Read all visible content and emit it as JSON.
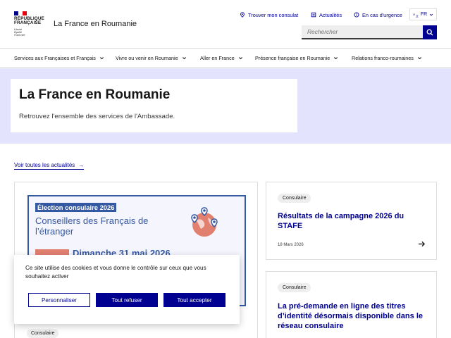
{
  "header": {
    "logo_lines": [
      "RÉPUBLIQUE",
      "FRANÇAISE"
    ],
    "logo_motto": [
      "Liberté",
      "Égalité",
      "Fraternité"
    ],
    "site_title": "La France en Roumanie",
    "top_links": [
      {
        "label": "Trouver mon consulat",
        "icon": "map-pin-icon"
      },
      {
        "label": "Actualités",
        "icon": "newspaper-icon"
      },
      {
        "label": "En cas d'urgence",
        "icon": "info-icon"
      }
    ],
    "language": "FR",
    "search_placeholder": "Rechercher"
  },
  "nav": {
    "items": [
      "Services aux Françaises et Français",
      "Vivre ou venir en Roumanie",
      "Aller en France",
      "Présence française en Roumanie",
      "Relations franco-roumaines"
    ]
  },
  "hero": {
    "title": "La France en Roumanie",
    "subtitle": "Retrouvez l'ensemble des services de l'Ambassade."
  },
  "news": {
    "all_link": "Voir toutes les actualités",
    "main": {
      "poster_tag": "Élection consulaire 2026",
      "poster_title": "Conseillers des Français de l’étranger",
      "poster_date": "Dimanche 31 mai 2026",
      "badge": "Consulaire"
    },
    "cards": [
      {
        "badge": "Consulaire",
        "title": "Résultats de la campagne 2026 du STAFE",
        "date": "18 Mars 2026"
      },
      {
        "badge": "Consulaire",
        "title": "La pré-demande en ligne des titres d’identité désormais disponible dans le réseau consulaire",
        "date": ""
      }
    ]
  },
  "cookie": {
    "text": "Ce site utilise des cookies et vous donne le contrôle sur ceux que vous souhaitez activer",
    "personalize": "Personnaliser",
    "refuse_all": "Tout refuser",
    "accept_all": "Tout accepter"
  },
  "colors": {
    "primary": "#000091",
    "hero_bg": "#e3e3fd",
    "flag_blue": "#000091",
    "flag_red": "#e1000f"
  }
}
